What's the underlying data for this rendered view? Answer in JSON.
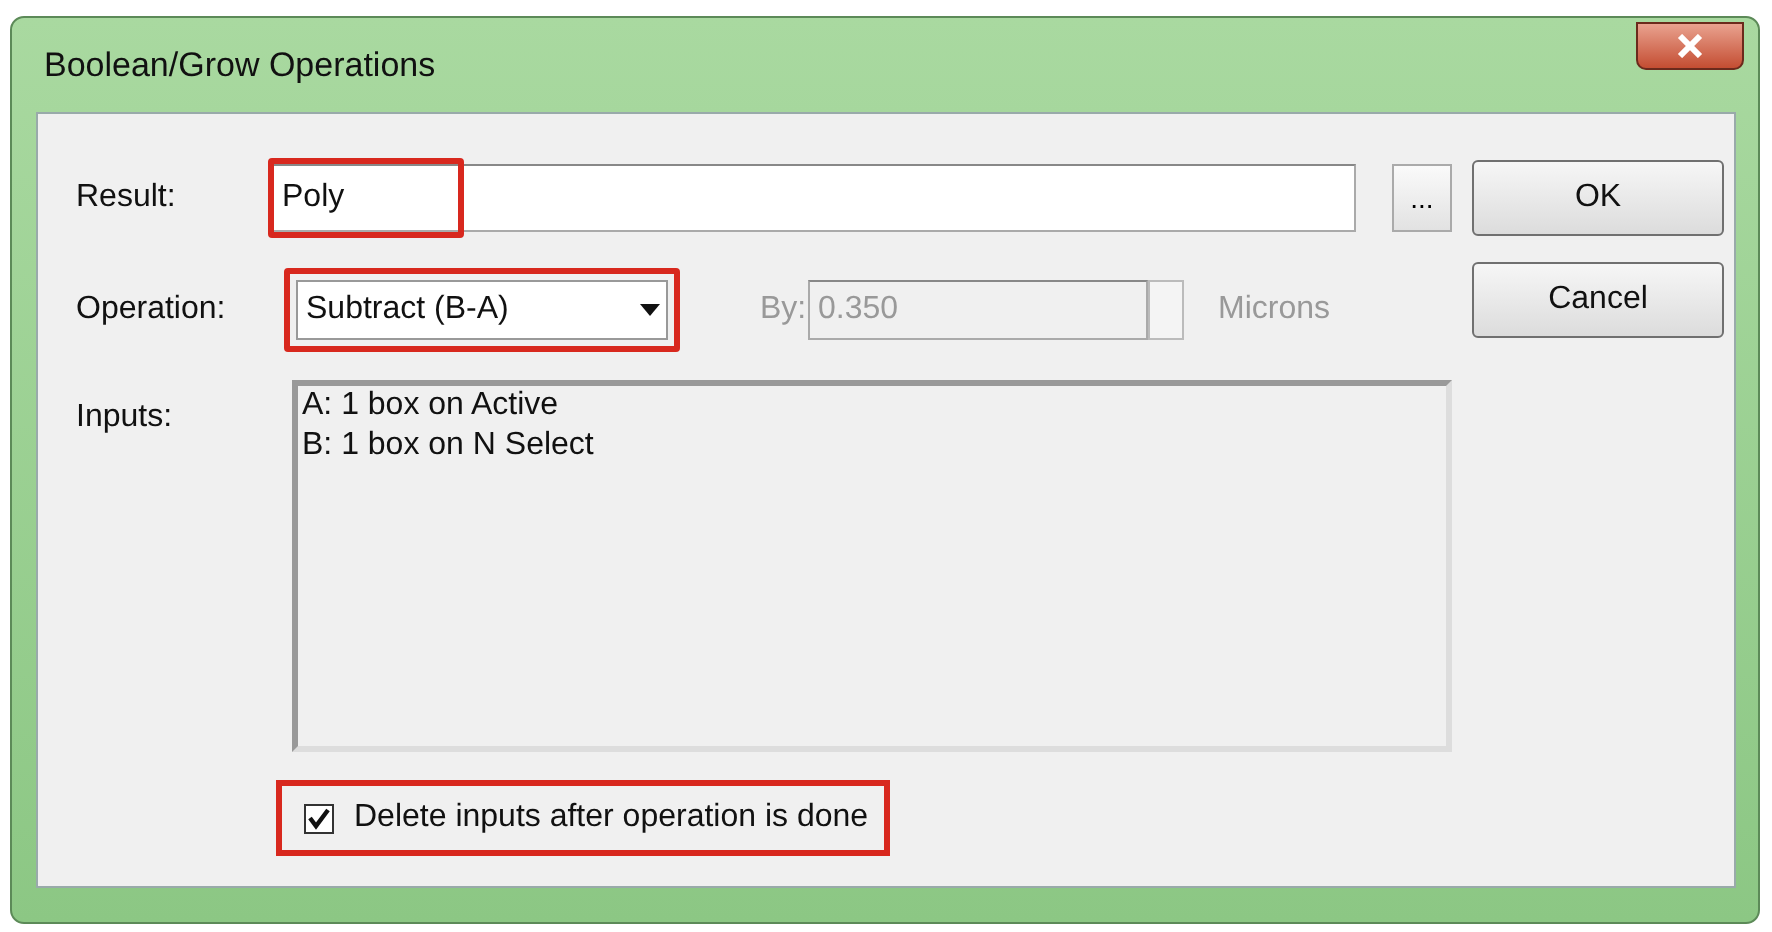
{
  "window": {
    "title": "Boolean/Grow Operations"
  },
  "result": {
    "label": "Result:",
    "value": "Poly",
    "highlighted": true
  },
  "browse_button": "...",
  "operation": {
    "label": "Operation:",
    "value": "Subtract (B-A)",
    "highlighted": true
  },
  "by": {
    "label": "By:",
    "value": "0.350",
    "unit": "Microns",
    "disabled": true
  },
  "inputs": {
    "label": "Inputs:",
    "lines": [
      "A: 1 box on Active",
      "B: 1 box on N Select"
    ]
  },
  "delete_inputs": {
    "label": "Delete inputs after operation is done",
    "checked": true,
    "highlighted": true
  },
  "buttons": [
    "OK",
    "Cancel"
  ]
}
